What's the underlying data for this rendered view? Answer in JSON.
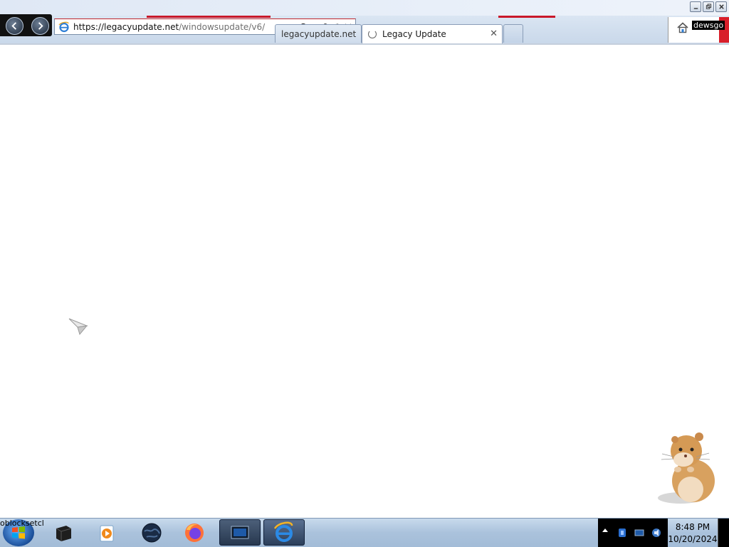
{
  "browser": {
    "address": {
      "host": "https://legacyupdate.net",
      "path": "/windowsupdate/v6/"
    },
    "tabs": [
      {
        "label": "legacyupdate.net"
      },
      {
        "label": "Legacy Update"
      }
    ],
    "tab_close_glyph": "✕",
    "overlay_text": "dewsgo",
    "icons": [
      "back-icon",
      "forward-icon",
      "ie-icon",
      "search-icon",
      "dropdown-icon",
      "lock-icon",
      "refresh-icon",
      "stop-icon",
      "home-icon",
      "minimize-icon",
      "restore-icon",
      "close-icon"
    ]
  },
  "taskbar": {
    "start_tooltip": "oblocksetcl",
    "items": [
      {
        "name": "terminal-app-icon"
      },
      {
        "name": "media-player-icon"
      },
      {
        "name": "globe-browser-icon"
      },
      {
        "name": "firefox-icon"
      },
      {
        "name": "remote-desktop-icon"
      },
      {
        "name": "internet-explorer-icon"
      }
    ],
    "clock": {
      "time": "8:48 PM",
      "date": "10/20/2024"
    }
  },
  "desktop": {
    "mascot": "hamster-mascot"
  },
  "colors": {
    "accent_red": "#c9182a",
    "chrome_blue": "#d3e0ef",
    "taskbar_blue": "#aac2dc"
  }
}
